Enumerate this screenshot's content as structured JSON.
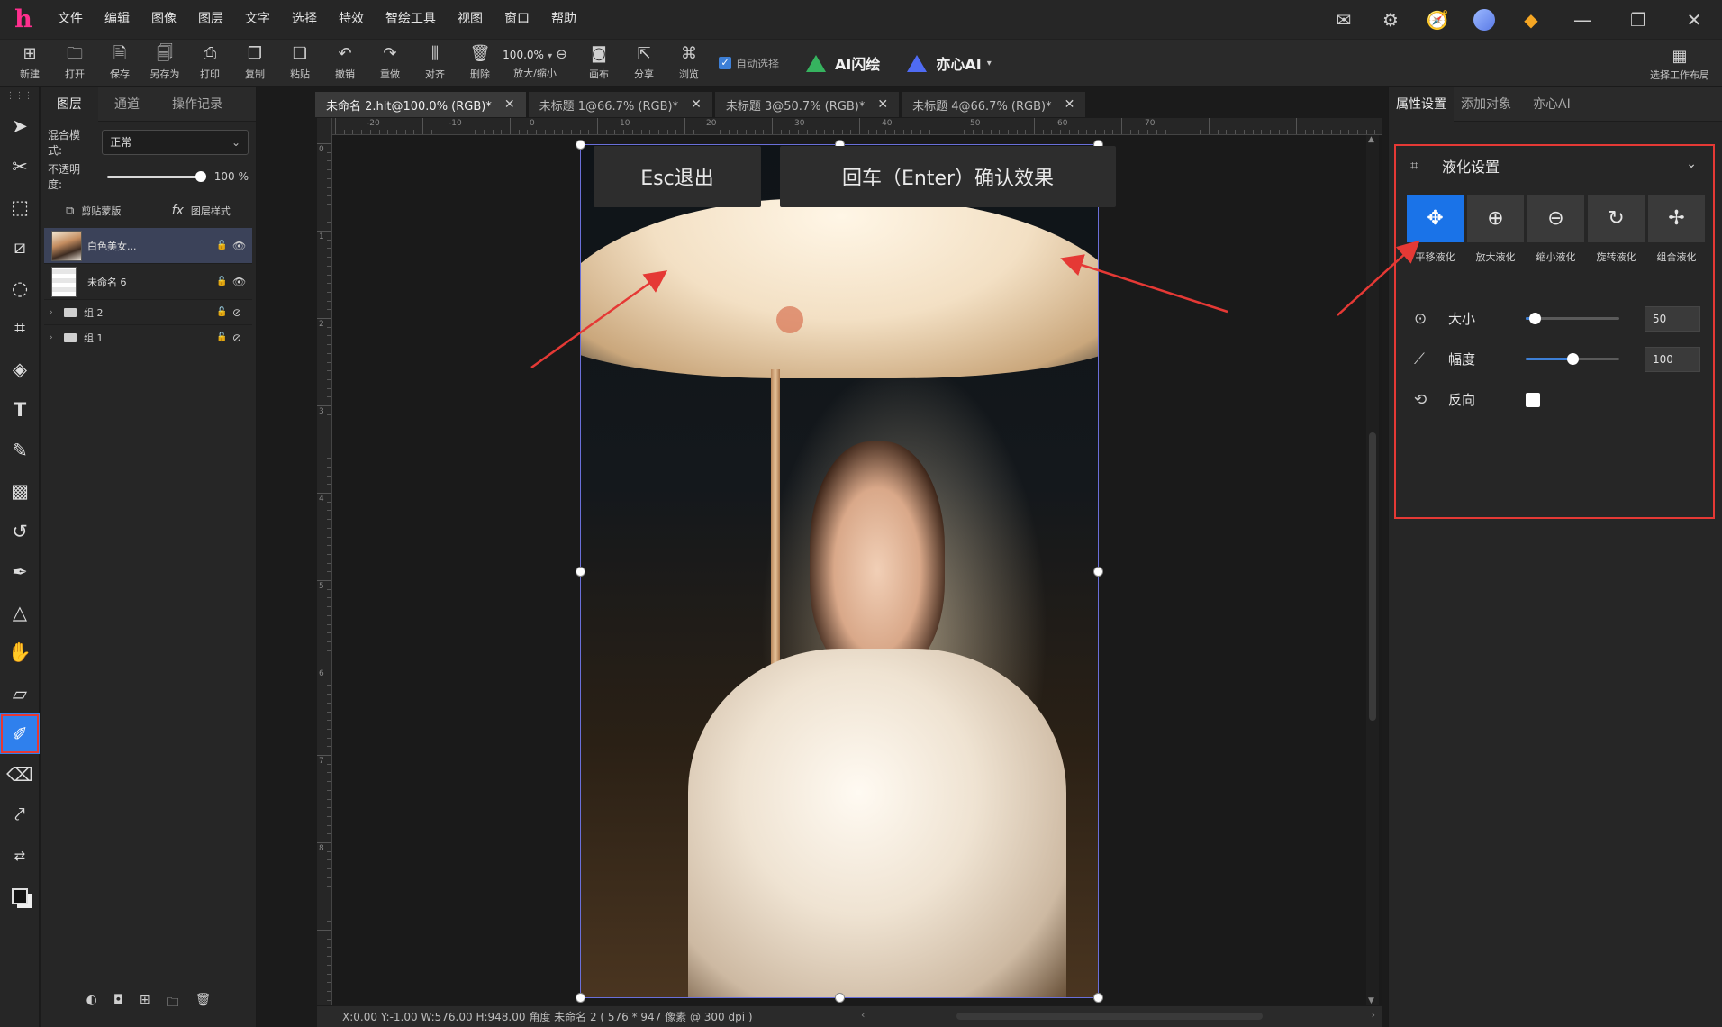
{
  "app": {
    "logo": "h",
    "menu": [
      "文件",
      "编辑",
      "图像",
      "图层",
      "文字",
      "选择",
      "特效",
      "智绘工具",
      "视图",
      "窗口",
      "帮助"
    ],
    "title_icons": [
      "mail-icon",
      "settings-icon",
      "compass-icon",
      "user-avatar-icon",
      "gem-icon",
      "minimize-icon",
      "restore-icon",
      "close-icon"
    ]
  },
  "toolbar": {
    "buttons": [
      {
        "label": "新建",
        "icon": "new-file-icon",
        "glyph": "⊞"
      },
      {
        "label": "打开",
        "icon": "open-folder-icon",
        "glyph": "🗀"
      },
      {
        "label": "保存",
        "icon": "save-icon",
        "glyph": "🗎"
      },
      {
        "label": "另存为",
        "icon": "save-as-icon",
        "glyph": "🗐"
      },
      {
        "label": "打印",
        "icon": "print-icon",
        "glyph": "⎙"
      },
      {
        "label": "复制",
        "icon": "copy-icon",
        "glyph": "❐"
      },
      {
        "label": "粘贴",
        "icon": "paste-icon",
        "glyph": "❏"
      },
      {
        "label": "撤销",
        "icon": "undo-icon",
        "glyph": "↶"
      },
      {
        "label": "重做",
        "icon": "redo-icon",
        "glyph": "↷"
      },
      {
        "label": "对齐",
        "icon": "align-icon",
        "glyph": "⫼"
      },
      {
        "label": "删除",
        "icon": "trash-icon",
        "glyph": "🗑"
      }
    ],
    "zoom": {
      "value": "100.0%",
      "label": "放大/缩小"
    },
    "buttons2": [
      {
        "label": "画布",
        "icon": "canvas-icon",
        "glyph": "◙"
      },
      {
        "label": "分享",
        "icon": "share-icon",
        "glyph": "⇱"
      },
      {
        "label": "浏览",
        "icon": "browse-icon",
        "glyph": "⌘"
      }
    ],
    "auto_select": "自动选择",
    "ai_flash": "AI闪绘",
    "yixin_ai": "亦心AI",
    "workspace": "选择工作布局"
  },
  "layers_panel": {
    "tabs": [
      "图层",
      "通道",
      "操作记录"
    ],
    "blend_label": "混合模式:",
    "blend_value": "正常",
    "opacity_label": "不透明度:",
    "opacity_value": "100",
    "opacity_unit": "%",
    "opacity_fraction": 1.0,
    "clip_mask": "剪贴蒙版",
    "layer_style": "图层样式",
    "layers": [
      {
        "name": "白色美女...",
        "type": "photo",
        "selected": true
      },
      {
        "name": "未命名 6",
        "type": "blank",
        "selected": false
      }
    ],
    "groups": [
      "组 2",
      "组 1"
    ]
  },
  "doc_tabs": [
    {
      "label": "未命名 2.hit@100.0% (RGB)*",
      "active": true
    },
    {
      "label": "未标题 1@66.7% (RGB)*",
      "active": false
    },
    {
      "label": "未标题 3@50.7% (RGB)*",
      "active": false
    },
    {
      "label": "未标题 4@66.7% (RGB)*",
      "active": false
    }
  ],
  "ruler_top_labels": [
    "-20",
    "-10",
    "0",
    "10",
    "20",
    "30",
    "40",
    "50",
    "60",
    "70"
  ],
  "ruler_left_labels": [
    "0",
    "1",
    "2",
    "3",
    "4",
    "5",
    "6",
    "7",
    "8"
  ],
  "canvas_hints": {
    "esc": "Esc退出",
    "enter": "回车（Enter）确认效果"
  },
  "status": {
    "text": "X:0.00 Y:-1.00 W:576.00 H:948.00 角度    未命名 2 ( 576 * 947 像素 @ 300 dpi )"
  },
  "props_panel": {
    "tabs": [
      "属性设置",
      "添加对象",
      "亦心AI"
    ],
    "liquify_title": "液化设置",
    "modes": [
      {
        "label": "平移液化",
        "icon": "move-arrows-icon",
        "glyph": "✥",
        "active": true
      },
      {
        "label": "放大液化",
        "icon": "zoom-in-icon",
        "glyph": "⊕",
        "active": false
      },
      {
        "label": "缩小液化",
        "icon": "zoom-out-icon",
        "glyph": "⊖",
        "active": false
      },
      {
        "label": "旋转液化",
        "icon": "rotate-icon",
        "glyph": "↻",
        "active": false
      },
      {
        "label": "组合液化",
        "icon": "combine-arrows-icon",
        "glyph": "✢",
        "active": false
      }
    ],
    "params": [
      {
        "name": "大小",
        "value": "50",
        "level": 0.1,
        "icon": "size-icon",
        "glyph": "⊙"
      },
      {
        "name": "幅度",
        "value": "100",
        "level": 0.5,
        "icon": "amplitude-icon",
        "glyph": "⟋"
      }
    ],
    "reverse_label": "反向"
  },
  "colors": {
    "accent": "#1a73e8",
    "highlight_red": "#e53935",
    "logo": "#ff2f8e"
  }
}
